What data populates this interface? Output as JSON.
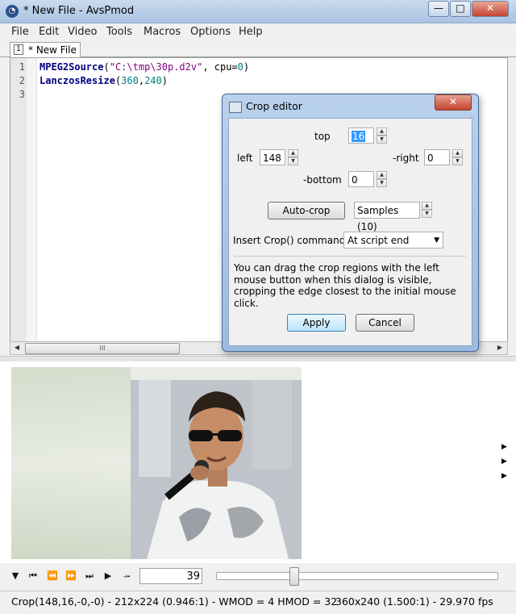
{
  "window": {
    "title": "* New File - AvsPmod"
  },
  "menu": [
    "File",
    "Edit",
    "Video",
    "Tools",
    "Macros",
    "Options",
    "Help"
  ],
  "tab": {
    "number": "1",
    "label": "* New File"
  },
  "editor": {
    "line_numbers": [
      "1",
      "2",
      "3"
    ],
    "line1": {
      "func": "MPEG2Source",
      "open": "(",
      "str": "\"C:\\tmp\\30p.d2v\"",
      "mid": ", cpu=",
      "num": "0",
      "close": ")"
    },
    "line2": {
      "func": "LanczosResize",
      "open": "(",
      "num1": "360",
      "comma": ",",
      "num2": "240",
      "close": ")"
    }
  },
  "hscroll_thumb": "III",
  "dialog": {
    "title": "Crop editor",
    "top_label": "top",
    "top_value": "16",
    "left_label": "left",
    "left_value": "148",
    "right_label": "-right",
    "right_value": "0",
    "bottom_label": "-bottom",
    "bottom_value": "0",
    "autocrop_label": "Auto-crop",
    "samples_value": "Samples (10)",
    "insert_label": "Insert Crop() command:",
    "insert_value": "At script end",
    "help_text": "You can drag the crop regions with the left mouse button when this dialog is visible, cropping the edge closest to the initial mouse click.",
    "apply_label": "Apply",
    "cancel_label": "Cancel"
  },
  "playback": {
    "frame": "39",
    "seek_fraction": 0.27
  },
  "status": {
    "left": "Crop(148,16,-0,-0) - 212x224 (0.946:1) - WMOD =  4  HMOD = 32",
    "right": "360x240 (1.500:1)  -  29.970 fps"
  }
}
